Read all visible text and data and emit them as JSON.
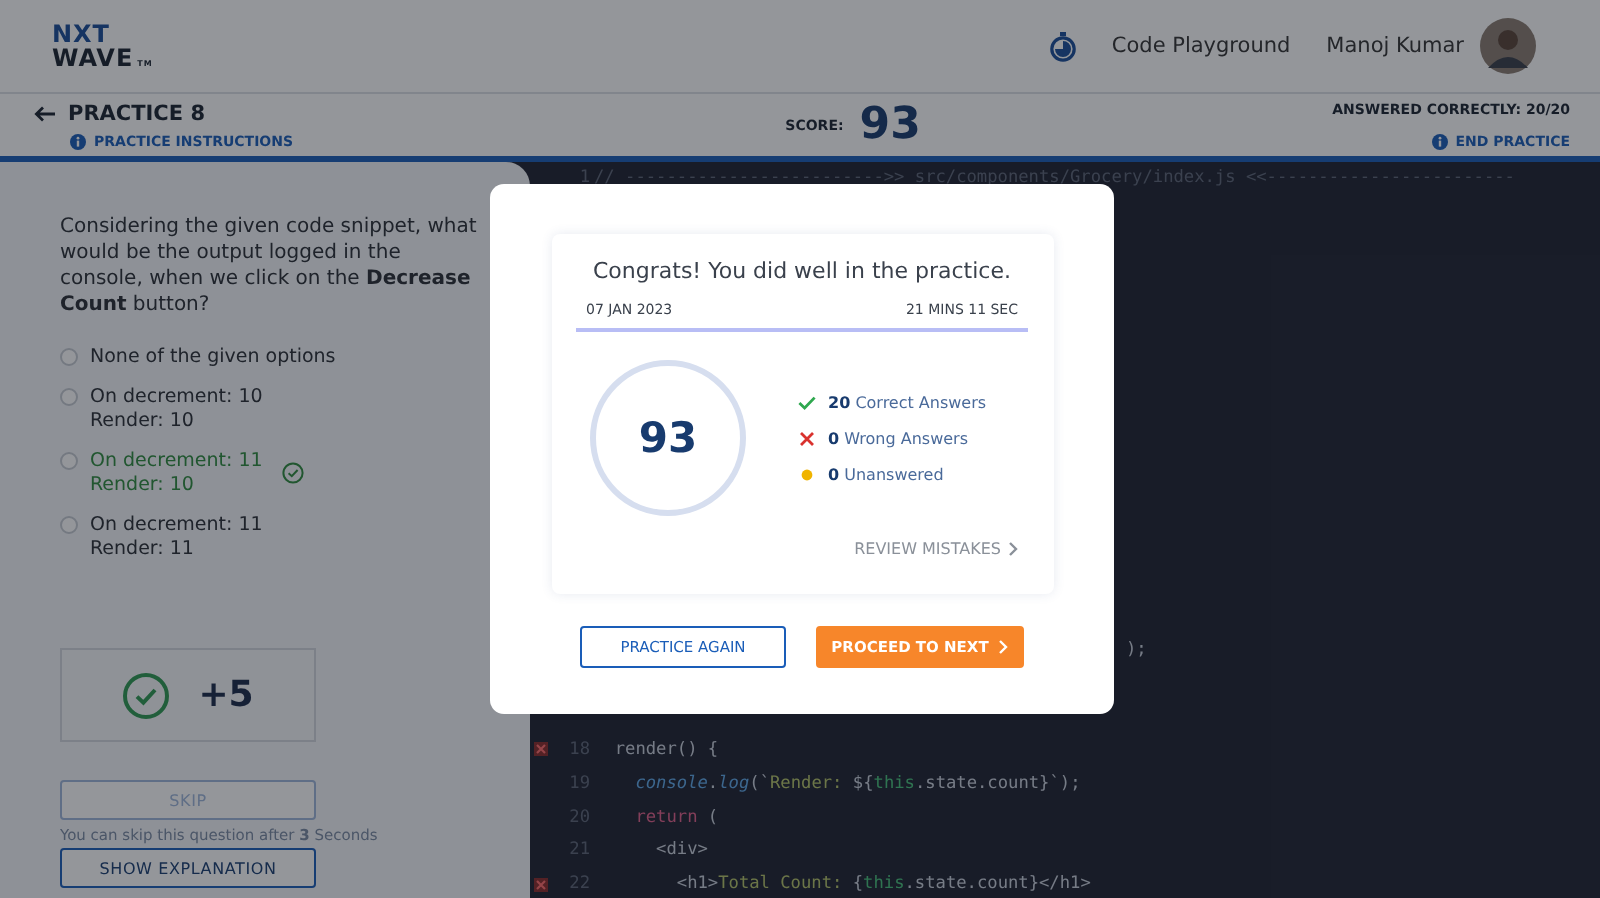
{
  "header": {
    "logo_top": "NXT",
    "logo_bottom": "WAVE",
    "logo_mark": "TM",
    "link": "Code Playground",
    "user": "Manoj Kumar"
  },
  "subheader": {
    "title": "PRACTICE 8",
    "instructions": "PRACTICE INSTRUCTIONS",
    "score_label": "SCORE:",
    "score": "93",
    "answered": "ANSWERED CORRECTLY: 20/20",
    "end": "END PRACTICE",
    "progress": {
      "level": 1
    }
  },
  "question": {
    "text": "Considering the given code snippet, what would be the output logged in the console, when we click on the **Decrease Count** button?",
    "options": [
      {
        "lines": [
          "None of the given options"
        ],
        "correct": false,
        "selected": false
      },
      {
        "lines": [
          "On decrement: 10",
          "Render: 10"
        ],
        "correct": false,
        "selected": false
      },
      {
        "lines": [
          "On decrement: 11",
          "Render: 10"
        ],
        "correct": true,
        "selected": false
      },
      {
        "lines": [
          "On decrement: 11",
          "Render: 11"
        ],
        "correct": false,
        "selected": false
      }
    ],
    "result": {
      "points": "+5"
    },
    "skip": {
      "label": "SKIP",
      "disabled": true
    },
    "skip_hint": "You can skip this question after **3** Seconds",
    "explanation": "SHOW EXPLANATION"
  },
  "code": [
    {
      "number": "1",
      "error": false,
      "tokens": [
        {
          "kind": "comment",
          "text": "// ------------------------->> src/components/Grocery/index.js <<------------------------"
        }
      ]
    },
    {
      "kind": "partial",
      "tokens": [
        {
          "kind": "plain",
          "text": ");"
        }
      ]
    },
    {
      "number": "18",
      "error": true,
      "tokens": [
        {
          "kind": "plain",
          "text": "  render() {"
        }
      ]
    },
    {
      "number": "19",
      "error": false,
      "tokens": [
        {
          "kind": "fn",
          "text": "    console"
        },
        {
          "kind": "plain",
          "text": "."
        },
        {
          "kind": "fn",
          "text": "log"
        },
        {
          "kind": "plain",
          "text": "(`"
        },
        {
          "kind": "string",
          "text": "Render: "
        },
        {
          "kind": "plain",
          "text": "${"
        },
        {
          "kind": "this",
          "text": "this"
        },
        {
          "kind": "plain",
          "text": ".state.count}`);"
        }
      ]
    },
    {
      "number": "20",
      "error": false,
      "tokens": [
        {
          "kind": "keyword",
          "text": "    return"
        },
        {
          "kind": "plain",
          "text": " ("
        }
      ]
    },
    {
      "number": "21",
      "error": false,
      "tokens": [
        {
          "kind": "plain",
          "text": "      <div>"
        }
      ]
    },
    {
      "number": "22",
      "error": true,
      "tokens": [
        {
          "kind": "plain",
          "text": "        <h1>"
        },
        {
          "kind": "string",
          "text": "Total Count: "
        },
        {
          "kind": "plain",
          "text": "{"
        },
        {
          "kind": "this",
          "text": "this"
        },
        {
          "kind": "plain",
          "text": ".state.count}</h1>"
        }
      ]
    }
  ],
  "modal": {
    "title": "Congrats! You did well in the practice.",
    "date": "07 JAN 2023",
    "duration": "21 MINS 11 SEC",
    "score": "93",
    "stats": [
      {
        "kind": "correct",
        "count": "20",
        "label": "Correct Answers"
      },
      {
        "kind": "wrong",
        "count": "0",
        "label": "Wrong Answers"
      },
      {
        "kind": "unanswered",
        "count": "0",
        "label": "Unanswered"
      }
    ],
    "review": "REVIEW MISTAKES",
    "buttons": [
      {
        "kind": "outline",
        "label": "PRACTICE AGAIN"
      },
      {
        "kind": "primary",
        "label": "PROCEED TO NEXT"
      }
    ]
  }
}
